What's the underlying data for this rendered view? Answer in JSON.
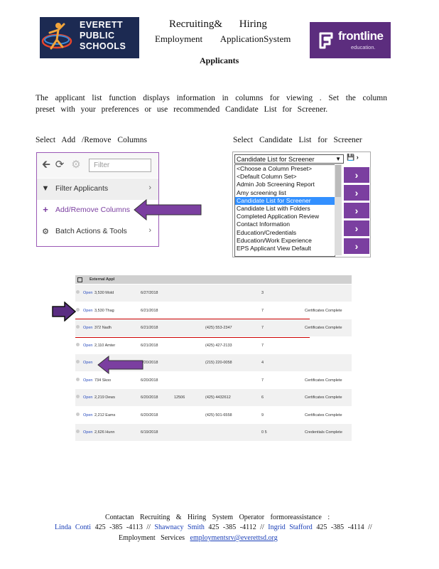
{
  "logos": {
    "left": {
      "line1": "EVERETT",
      "line2": "PUBLIC",
      "line3": "SCHOOLS"
    },
    "right": {
      "name": "frontline",
      "sub": "education."
    }
  },
  "heading": {
    "line1": "Recruiting&    Hiring",
    "line2": "Employment    ApplicationSystem",
    "line3": "Applicants"
  },
  "intro": "The applicant   list function   displays  information   in columns   for viewing  . Set the column   preset with your preferences   or use recommended   Candidate   List for Screener.",
  "labels": {
    "left": "Select Add /Remove   Columns",
    "right": "Select Candidate   List for Screener"
  },
  "panel": {
    "filter_placeholder": "Filter",
    "items": [
      {
        "label": "Filter Applicants"
      },
      {
        "label": "Add/Remove Columns"
      },
      {
        "label": "Batch Actions & Tools"
      }
    ]
  },
  "dropdown": {
    "selected": "Candidate List for Screener",
    "options": [
      "<Choose a Column Preset>",
      "<Default Column Set>",
      "Admin Job Screening Report",
      "Amy screening list",
      "Candidate List for Screener",
      "Candidate List with Folders",
      "Completed Application Review",
      "Contact Information",
      "Education/Credentials",
      "Education/Work Experience",
      "EPS Applicant View Default"
    ],
    "highlight_index": 4
  },
  "table": {
    "header": "External Appl",
    "rows": [
      [
        "Open",
        "3,530 Mold",
        "6/27/2018",
        "",
        "",
        "3",
        ""
      ],
      [
        "Open",
        "3,530 Thag",
        "6/21/2018",
        "",
        "",
        "7",
        "Certificates Complete"
      ],
      [
        "Open",
        "372 Nadh",
        "6/21/2018",
        "",
        "(425) 553-2347",
        "7",
        "Certificates Complete"
      ],
      [
        "Open",
        "2,110 Amter",
        "6/21/2018",
        "",
        "(425) 427-2133",
        "7",
        ""
      ],
      [
        "Open",
        "",
        "6/20/2018",
        "",
        "(215) 220-0058",
        "4",
        ""
      ],
      [
        "Open",
        "734 Skoo",
        "6/20/2018",
        "",
        "",
        "7",
        "Certificates Complete"
      ],
      [
        "Open",
        "2,219 Dews",
        "6/20/2018",
        "12506",
        "(425) 4432612",
        "6",
        "Certificates Complete"
      ],
      [
        "Open",
        "2,212 Eams",
        "6/20/2018",
        "",
        "(425) 501-6558",
        "9",
        "Certificates Complete"
      ],
      [
        "Open",
        "2,626 Hunn",
        "6/19/2018",
        "",
        "",
        "0 5",
        "Credentials Complete"
      ]
    ]
  },
  "footer": {
    "line1": "Contactan   Recruiting   & Hiring System  Operator   formoreassistance      :",
    "contacts": [
      {
        "name": "Linda  Conti",
        "phone": "425 -385 -4113"
      },
      {
        "name": "Shawnacy   Smith",
        "phone": "425 -385 -4112"
      },
      {
        "name": "Ingrid  Stafford",
        "phone": "425 -385 -4114"
      }
    ],
    "line3_prefix": "Employment   Services",
    "email": "employmentsrv@everettsd.org"
  },
  "colors": {
    "accent": "#7b3fa0",
    "link": "#1a3fb8",
    "highlight": "#3390ff"
  }
}
